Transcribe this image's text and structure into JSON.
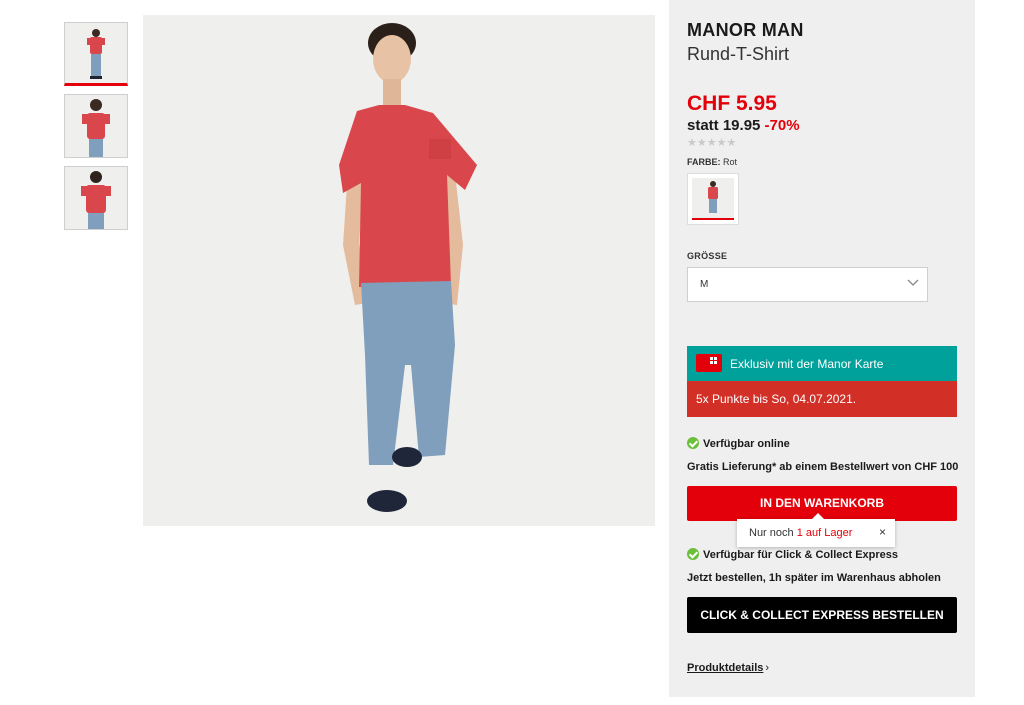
{
  "product": {
    "brand": "MANOR MAN",
    "name": "Rund-T-Shirt",
    "price": "CHF 5.95",
    "old_price_prefix": "statt 19.95",
    "discount": "-70%",
    "rating_stars": "★★★★★",
    "color_label": "FARBE:",
    "color_value": "Rot",
    "size_label": "GRÖSSE",
    "size_value": "M"
  },
  "promo": {
    "card_text": "Exklusiv mit der Manor Karte",
    "points_text": "5x Punkte bis So, 04.07.2021."
  },
  "availability": {
    "online": "Verfügbar online",
    "delivery": "Gratis Lieferung* ab einem Bestellwert von CHF 100",
    "cart_button": "IN DEN WARENKORB",
    "stock_prefix": "Nur noch",
    "stock_highlight": "1 auf Lager",
    "stock_close": "×",
    "click_collect": "Verfügbar für Click & Collect Express",
    "pickup": "Jetzt bestellen, 1h später im Warenhaus abholen",
    "cc_button": "CLICK & COLLECT EXPRESS BESTELLEN",
    "details_link": "Produktdetails",
    "details_arrow": "›"
  },
  "colors": {
    "accent_red": "#e3000b",
    "teal": "#00a19a",
    "promo_red": "#d22f27",
    "shirt": "#d9474c",
    "jeans": "#7f9fbd"
  },
  "icons": {
    "check": "check-circle-icon",
    "card": "manor-card-icon",
    "chevron": "chevron-down-icon",
    "close": "close-icon"
  }
}
